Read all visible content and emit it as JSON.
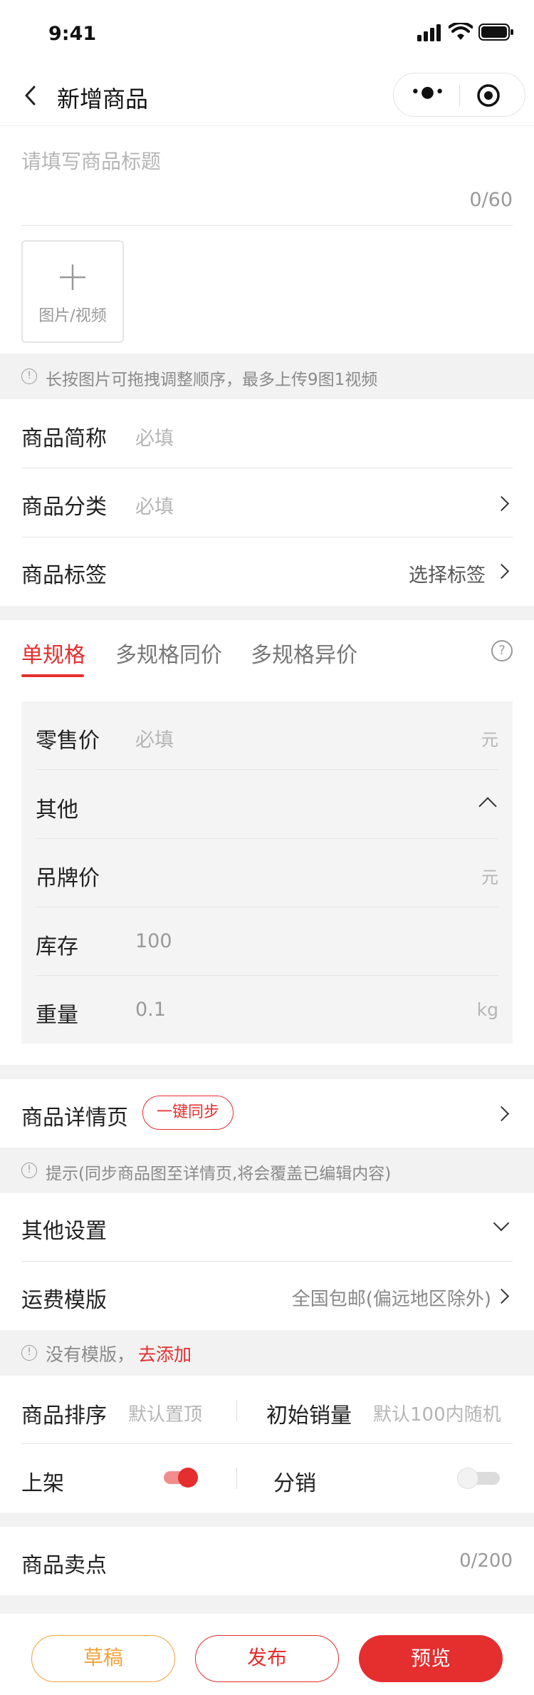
{
  "status_bar": {
    "time": "9:41"
  },
  "nav": {
    "title": "新增商品",
    "more_glyph": "•●•"
  },
  "title_field": {
    "placeholder": "请填写商品标题",
    "counter": "0/60"
  },
  "media": {
    "upload_label": "图片/视频",
    "tip": "长按图片可拖拽调整顺序，最多上传9图1视频"
  },
  "basic": {
    "short_name_label": "商品简称",
    "short_name_placeholder": "必填",
    "category_label": "商品分类",
    "category_placeholder": "必填",
    "tags_label": "商品标签",
    "tags_value": "选择标签"
  },
  "spec_tabs": [
    {
      "label": "单规格",
      "active": true
    },
    {
      "label": "多规格同价",
      "active": false
    },
    {
      "label": "多规格异价",
      "active": false
    }
  ],
  "spec": {
    "price_label": "零售价",
    "price_placeholder": "必填",
    "price_unit": "元",
    "other_label": "其他",
    "tag_price_label": "吊牌价",
    "tag_price_unit": "元",
    "stock_label": "库存",
    "stock_value": "100",
    "weight_label": "重量",
    "weight_value": "0.1",
    "weight_unit": "kg"
  },
  "detail": {
    "label": "商品详情页",
    "sync_button": "一键同步",
    "tip": "提示(同步商品图至详情页,将会覆盖已编辑内容)"
  },
  "other_settings": {
    "label": "其他设置",
    "shipping_label": "运费模版",
    "shipping_value": "全国包邮(偏远地区除外)",
    "template_tip": "没有模版，",
    "template_link": "去添加"
  },
  "options": {
    "sort_label": "商品排序",
    "sort_placeholder": "默认置顶",
    "initial_sales_label": "初始销量",
    "initial_sales_placeholder": "默认100内随机",
    "on_shelf_label": "上架",
    "on_shelf": true,
    "distribution_label": "分销",
    "distribution": false
  },
  "selling_point": {
    "label": "商品卖点",
    "counter": "0/200"
  },
  "footer": {
    "draft": "草稿",
    "publish": "发布",
    "preview": "预览"
  },
  "colors": {
    "accent": "#e52e2e",
    "draft": "#f0a23a",
    "background": "#f2f2f2"
  },
  "icons": {
    "back": "chevron-left-icon",
    "more": "more-dots-icon",
    "target": "target-icon",
    "plus": "plus-icon",
    "info": "info-icon",
    "help": "question-icon",
    "arrow": "chevron-right-icon"
  }
}
